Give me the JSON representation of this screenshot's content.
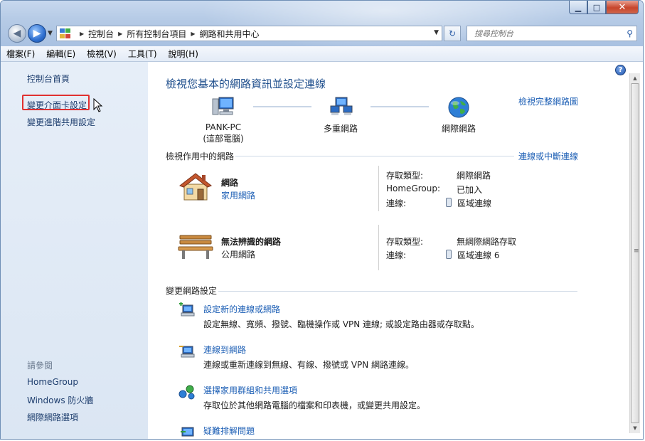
{
  "address": {
    "crumbs": [
      "控制台",
      "所有控制台項目",
      "網路和共用中心"
    ]
  },
  "search": {
    "placeholder": "搜尋控制台"
  },
  "menu": [
    "檔案(F)",
    "編輯(E)",
    "檢視(V)",
    "工具(T)",
    "說明(H)"
  ],
  "left": {
    "home": "控制台首頁",
    "adapter": "變更介面卡設定",
    "advanced": "變更進階共用設定",
    "see_also": "請參閱",
    "links": [
      "HomeGroup",
      "Windows 防火牆",
      "網際網路選項"
    ]
  },
  "main": {
    "title": "檢視您基本的網路資訊並設定連線",
    "full_map": "檢視完整網路圖",
    "nodes": [
      {
        "label1": "PANK-PC",
        "label2": "(這部電腦)"
      },
      {
        "label1": "多重網路",
        "label2": ""
      },
      {
        "label1": "網際網路",
        "label2": ""
      }
    ],
    "active_head": "檢視作用中的網路",
    "connect_link": "連線或中斷連線",
    "networks": [
      {
        "name": "網路",
        "type": "家用網路",
        "rows": [
          {
            "label": "存取類型:",
            "value": "網際網路"
          },
          {
            "label": "HomeGroup:",
            "value": "已加入"
          },
          {
            "label": "連線:",
            "value": "區域連線"
          }
        ]
      },
      {
        "name": "無法辨識的網路",
        "type": "公用網路",
        "rows": [
          {
            "label": "存取類型:",
            "value": "無網際網路存取"
          },
          {
            "label": "連線:",
            "value": "區域連線 6"
          }
        ]
      }
    ],
    "change_head": "變更網路設定",
    "tasks": [
      {
        "title": "設定新的連線或網路",
        "desc": "設定無線、寬頻、撥號、臨機操作或 VPN 連線; 或設定路由器或存取點。"
      },
      {
        "title": "連線到網路",
        "desc": "連線或重新連線到無線、有線、撥號或 VPN 網路連線。"
      },
      {
        "title": "選擇家用群組和共用選項",
        "desc": "存取位於其他網路電腦的檔案和印表機，或變更共用設定。"
      },
      {
        "title": "疑難排解問題",
        "desc": ""
      }
    ]
  }
}
